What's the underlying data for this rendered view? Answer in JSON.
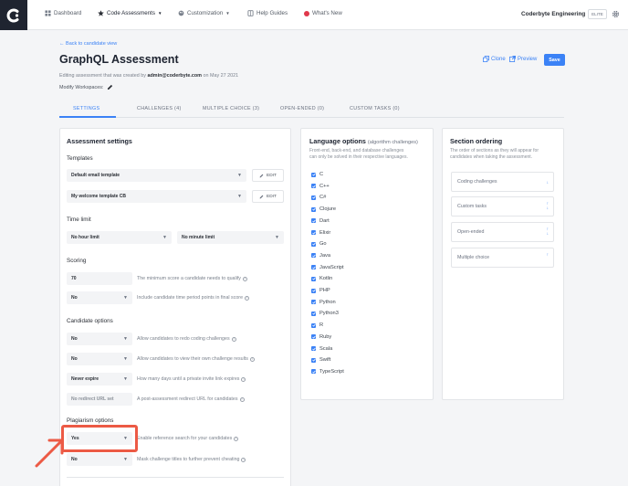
{
  "nav": {
    "items": [
      {
        "label": "Dashboard",
        "icon": "dashboard-icon"
      },
      {
        "label": "Code Assessments",
        "icon": "star-icon",
        "dropdown": true
      },
      {
        "label": "Customization",
        "icon": "brush-icon",
        "dropdown": true
      },
      {
        "label": "Help Guides",
        "icon": "book-icon"
      },
      {
        "label": "What's New",
        "icon": "notification-dot-icon"
      }
    ],
    "org_name": "Coderbyte Engineering",
    "plan_badge": "ELITE"
  },
  "header": {
    "back_link": "← Back to candidate view",
    "title": "GraphQL Assessment",
    "editing_prefix": "Editing assessment that was created by ",
    "editing_author": "admin@coderbyte.com",
    "editing_suffix": " on May 27 2021",
    "modify_workspaces": "Modify Workspaces:",
    "clone_label": "Clone",
    "preview_label": "Preview",
    "save_label": "Save"
  },
  "tabs": [
    "SETTINGS",
    "CHALLENGES (4)",
    "MULTIPLE CHOICE (3)",
    "OPEN-ENDED (0)",
    "CUSTOM TASKS (0)"
  ],
  "settings": {
    "heading": "Assessment settings",
    "templates_label": "Templates",
    "template_1": "Default email template",
    "template_2": "My welcome template CB",
    "edit_label": "EDIT",
    "time_limit_label": "Time limit",
    "hour_limit": "No hour limit",
    "minute_limit": "No minute limit",
    "scoring_label": "Scoring",
    "min_score": "70",
    "min_score_desc": "The minimum score a candidate needs to qualify",
    "include_time": "No",
    "include_time_desc": "Include candidate time period points in final score",
    "candidate_options_label": "Candidate options",
    "redo": "No",
    "redo_desc": "Allow candidates to redo coding challenges",
    "view_results": "No",
    "view_results_desc": "Allow candidates to view their own challenge results",
    "expire": "Never expire",
    "expire_desc": "How many days until a private invite link expires",
    "redirect_placeholder": "No redirect URL set",
    "redirect_desc": "A post-assessment redirect URL for candidates",
    "plagiarism_label": "Plagiarism options",
    "reference_search": "Yes",
    "reference_search_desc": "Enable reference search for your candidates",
    "mask_titles": "No",
    "mask_titles_desc": "Mask challenge titles to further prevent cheating"
  },
  "languages": {
    "heading": "Language options",
    "heading_note": "(algorithm challenges)",
    "description_1": "Front-end, back-end, and database challenges",
    "description_2": "can only be solved in their respective languages.",
    "items": [
      "C",
      "C++",
      "C#",
      "Clojure",
      "Dart",
      "Elixir",
      "Go",
      "Java",
      "JavaScript",
      "Kotlin",
      "PHP",
      "Python",
      "Python3",
      "R",
      "Ruby",
      "Scala",
      "Swift",
      "TypeScript"
    ]
  },
  "ordering": {
    "heading": "Section ordering",
    "description_1": "The order of sections as they will appear for",
    "description_2": "candidates when taking the assessment.",
    "items": [
      "Coding challenges",
      "Custom tasks",
      "Open-ended",
      "Multiple choice"
    ]
  },
  "colors": {
    "accent": "#3b82f6",
    "highlight": "#ec5a45",
    "logo_bg": "#1f2430"
  }
}
